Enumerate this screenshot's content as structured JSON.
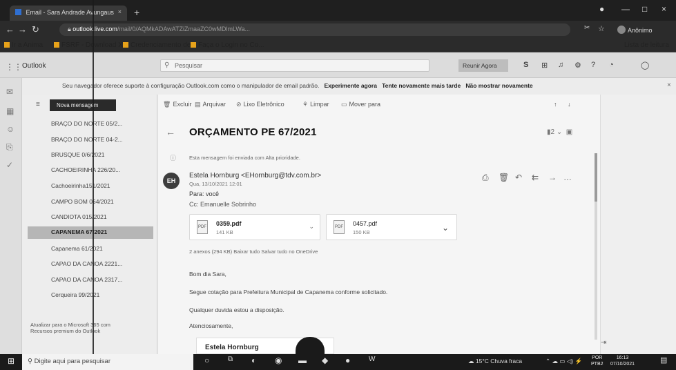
{
  "browser": {
    "tab_title": "Email - Sara Andrade Avungaus",
    "tab_close": "×",
    "new_tab": "+",
    "window_controls": [
      "—",
      "□",
      "×"
    ],
    "url_host": "outlook.live.com",
    "url_path": "/mail/0/AQMkADAwATZiZmaaZC0wMDlmLWa...",
    "profile_label": "Anônimo",
    "bookmarks": [
      "Ir a Anima",
      "FSRF - Download X...",
      "Credenciamento de...",
      "Faça o Login no Co..."
    ],
    "reading_list": "Lista de leitura"
  },
  "outlook": {
    "app_name": "Outlook",
    "search_placeholder": "Pesquisar",
    "meet_now": "Reunir Agora",
    "banner_text": "Seu navegador oferece suporte à configuração Outlook.com como o manipulador de email padrão.",
    "banner_try": "Experimente agora",
    "banner_later": "Tente novamente mais tarde",
    "banner_never": "Não mostrar novamente",
    "new_message": "Nova mensagem",
    "folders": [
      "BRAÇO DO NORTE 05/2...",
      "BRAÇO DO NORTE 04-2...",
      "BRUSQUE 0/6/2021",
      "CACHOEIRINHA 226/20...",
      "Cachoeirinha151/2021",
      "CAMPO BOM 064/2021",
      "CANDIOTA 015/2021",
      "CAPANEMA 67/2021",
      "Capanema 61/2021",
      "CAPAO DA CANOA 2221...",
      "CAPAO DA CANOA 2317...",
      "Cerqueira 99/2021"
    ],
    "selected_folder_index": 7,
    "promo_text": "Atualizar para o Microsoft 365 com Recursos premium do Outlook"
  },
  "commands": {
    "delete": "Excluir",
    "archive": "Arquivar",
    "junk": "Lixo Eletrônico",
    "sweep": "Limpar",
    "move_to": "Mover para"
  },
  "message": {
    "subject": "ORÇAMENTO PE 67/2021",
    "subject_meta": "2",
    "priority_note": "Esta mensagem foi enviada com Alta prioridade.",
    "sender_initials": "EH",
    "from": "Estela Hornburg <EHornburg@tdv.com.br>",
    "date": "Qua, 13/10/2021 12:01",
    "to": "Para: você",
    "cc": "Cc: Emanuelle Sobrinho",
    "attachments": [
      {
        "name": "0359.pdf",
        "size": "141 KB"
      },
      {
        "name": "0457.pdf",
        "size": "150 KB"
      }
    ],
    "attachment_summary": "2 anexos (294 KB)   Baixar tudo   Salvar tudo no OneDrive",
    "body": [
      "Bom dia Sara,",
      "Segue cotação para Prefeitura Municipal de Capanema conforme solicitado.",
      "Qualquer duvida estou a disposição.",
      "Atenciosamente,"
    ],
    "signature": "Estela Hornburg"
  },
  "taskbar": {
    "search_placeholder": "Digite aqui para pesquisar",
    "weather": "15°C  Chuva fraca",
    "language": "POR",
    "language_sub": "PTB2",
    "time": "16:13",
    "date": "07/10/2021"
  },
  "icons": {
    "start": "windows-logo-icon",
    "search": "search-icon",
    "avatar_color": "#3d3d3d",
    "selected_folder_color": "#b6b6b6"
  }
}
